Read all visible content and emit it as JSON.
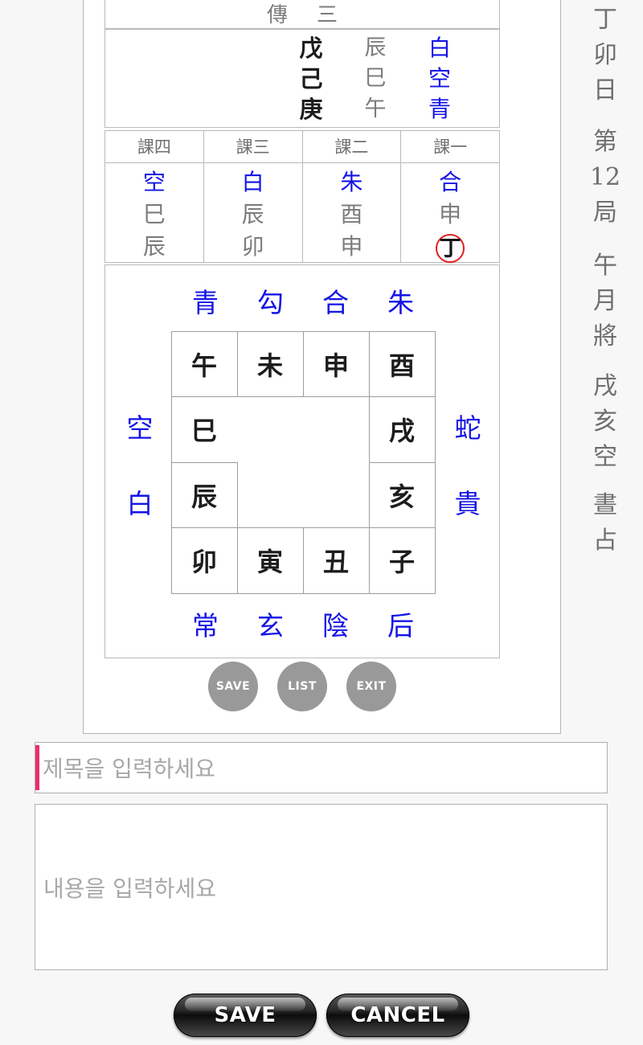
{
  "card": {
    "sanchuan_header": [
      "傳",
      "三"
    ],
    "sanchuan_rows": [
      {
        "gan": "戊",
        "zhi": "辰",
        "shen": "白"
      },
      {
        "gan": "己",
        "zhi": "巳",
        "shen": "空"
      },
      {
        "gan": "庚",
        "zhi": "午",
        "shen": "青"
      }
    ],
    "ke_columns": [
      {
        "head": "課四",
        "shen": "空",
        "zhi_upper": "巳",
        "zhi_lower": "辰",
        "marked": false,
        "mark": ""
      },
      {
        "head": "課三",
        "shen": "白",
        "zhi_upper": "辰",
        "zhi_lower": "卯",
        "marked": false,
        "mark": ""
      },
      {
        "head": "課二",
        "shen": "朱",
        "zhi_upper": "酉",
        "zhi_lower": "申",
        "marked": false,
        "mark": ""
      },
      {
        "head": "課一",
        "shen": "合",
        "zhi_upper": "申",
        "zhi_lower": "",
        "marked": true,
        "mark": "丁"
      }
    ],
    "palace": {
      "top_gods": [
        "青",
        "勾",
        "合",
        "朱"
      ],
      "bottom_gods": [
        "常",
        "玄",
        "陰",
        "后"
      ],
      "left_gods": [
        "空",
        "白"
      ],
      "right_gods": [
        "蛇",
        "貴"
      ],
      "grid": [
        "午",
        "未",
        "申",
        "酉",
        "巳",
        "",
        "",
        "戌",
        "辰",
        "",
        "",
        "亥",
        "卯",
        "寅",
        "丑",
        "子"
      ]
    },
    "round_buttons": [
      {
        "label": "SAVE",
        "name": "save"
      },
      {
        "label": "LIST",
        "name": "list"
      },
      {
        "label": "EXIT",
        "name": "exit"
      }
    ]
  },
  "info_column": {
    "day": [
      "丁",
      "卯",
      "日"
    ],
    "ju": [
      "第",
      "12",
      "局"
    ],
    "yuejiang": [
      "午",
      "月",
      "將"
    ],
    "kong": [
      "戌",
      "亥",
      "空"
    ],
    "zhan": [
      "晝",
      "占"
    ]
  },
  "form": {
    "title_placeholder": "제목을 입력하세요",
    "title_value": "",
    "content_placeholder": "내용을 입력하세요",
    "content_value": ""
  },
  "footer": {
    "save_label": "SAVE",
    "cancel_label": "CANCEL"
  },
  "colors": {
    "god_blue": "#1414e6",
    "zhi_gray": "#7c7c7c",
    "mark_red": "#e02020",
    "caret_pink": "#ec2e6e",
    "round_btn_gray": "#999999",
    "page_bg": "#f7f7f7"
  }
}
